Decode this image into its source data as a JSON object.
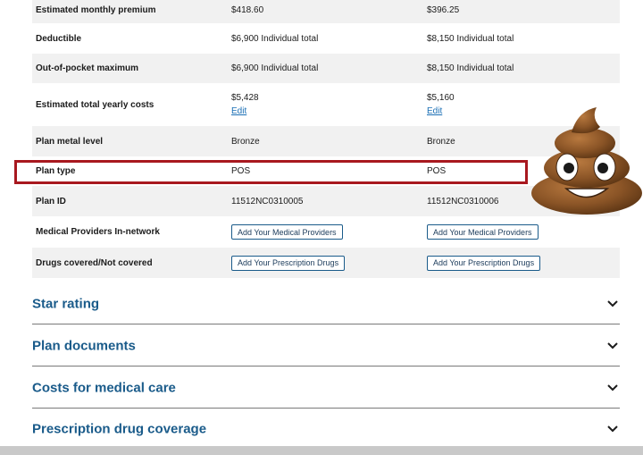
{
  "rows": [
    {
      "label": "Estimated monthly premium",
      "plan1": "$418.60",
      "plan2": "$396.25"
    },
    {
      "label": "Deductible",
      "plan1": "$6,900 Individual total",
      "plan2": "$8,150 Individual total"
    },
    {
      "label": "Out-of-pocket maximum",
      "plan1": "$6,900 Individual total",
      "plan2": "$8,150 Individual total"
    },
    {
      "label": "Estimated total yearly costs",
      "plan1": "$5,428",
      "plan2": "$5,160",
      "edit_label": "Edit"
    },
    {
      "label": "Plan metal level",
      "plan1": "Bronze",
      "plan2": "Bronze"
    },
    {
      "label": "Plan type",
      "plan1": "POS",
      "plan2": "POS"
    },
    {
      "label": "Plan ID",
      "plan1": "11512NC0310005",
      "plan2": "11512NC0310006"
    },
    {
      "label": "Medical Providers In-network",
      "button": "Add Your Medical Providers"
    },
    {
      "label": "Drugs covered/Not covered",
      "button": "Add Your Prescription Drugs"
    }
  ],
  "accordions": [
    {
      "title": "Star rating"
    },
    {
      "title": "Plan documents"
    },
    {
      "title": "Costs for medical care"
    },
    {
      "title": "Prescription drug coverage"
    }
  ],
  "overlay": {
    "icon": "pile-of-poo-emoji-icon",
    "highlight_color": "#a8181f"
  },
  "colors": {
    "accent": "#1a5b8a",
    "link": "#1a6fb5",
    "row_shade": "#f1f1f1"
  }
}
